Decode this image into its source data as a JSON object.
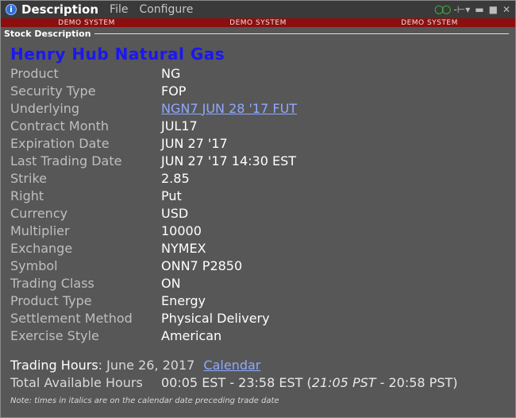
{
  "window": {
    "title": "Description",
    "menu": [
      "File",
      "Configure"
    ]
  },
  "demo_labels": [
    "DEMO SYSTEM",
    "DEMO SYSTEM",
    "DEMO SYSTEM"
  ],
  "section": {
    "label": "Stock Description"
  },
  "heading": "Henry Hub Natural Gas",
  "fields": [
    {
      "label": "Product",
      "value": "NG"
    },
    {
      "label": "Security Type",
      "value": "FOP"
    },
    {
      "label": "Underlying",
      "value": "NGN7 JUN 28 '17 FUT"
    },
    {
      "label": "Contract Month",
      "value": "JUL17"
    },
    {
      "label": "Expiration Date",
      "value": "JUN 27 '17"
    },
    {
      "label": "Last Trading Date",
      "value": "JUN 27 '17 14:30 EST"
    },
    {
      "label": "Strike",
      "value": "2.85"
    },
    {
      "label": "Right",
      "value": "Put"
    },
    {
      "label": "Currency",
      "value": "USD"
    },
    {
      "label": "Multiplier",
      "value": "10000"
    },
    {
      "label": "Exchange",
      "value": "NYMEX"
    },
    {
      "label": "Symbol",
      "value": "ONN7 P2850"
    },
    {
      "label": "Trading Class",
      "value": "ON"
    },
    {
      "label": "Product Type",
      "value": "Energy"
    },
    {
      "label": "Settlement Method",
      "value": "Physical Delivery"
    },
    {
      "label": "Exercise Style",
      "value": "American"
    }
  ],
  "trading_hours": {
    "label": "Trading Hours",
    "date": ": June 26, 2017",
    "calendar_link": "Calendar"
  },
  "available_hours": {
    "label": "Total Available Hours",
    "value_prefix": "00:05 EST - 23:58 EST (",
    "value_italic": "21:05 PST",
    "value_suffix": " - 20:58 PST)"
  },
  "note": "Note: times in italics are on the calendar date preceding trade date",
  "colors": {
    "heading": "#1b17ee",
    "link": "#8ea9ff",
    "demo_bar": "#8b0f0f",
    "background": "#575757",
    "titlebar": "#3a3a3a",
    "link_icon": "#39d33b"
  },
  "icons": [
    "info-icon",
    "link-icon",
    "pin-icon",
    "minimize-icon",
    "maximize-icon",
    "close-icon"
  ]
}
